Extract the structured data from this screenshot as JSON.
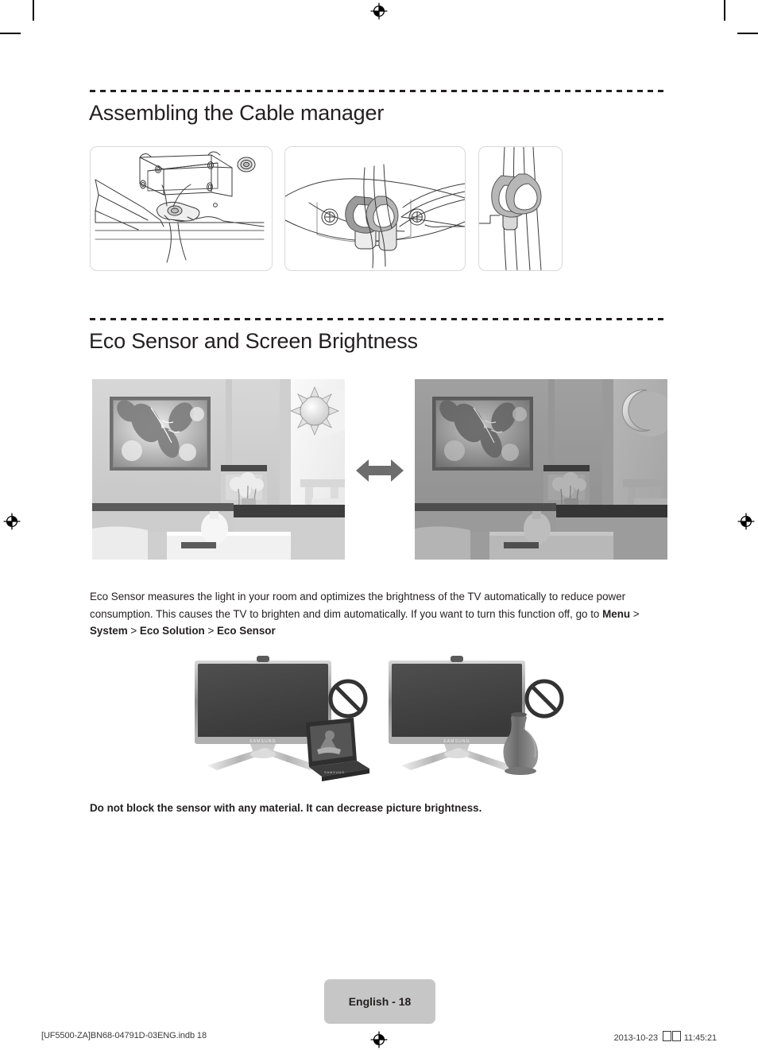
{
  "document": {
    "page_label": "English - 18",
    "footer_left": "[UF5500-ZA]BN68-04791D-03ENG.indb   18",
    "footer_date": "2013-10-23",
    "footer_time": "11:45:21",
    "footer_meridiem_glyphs": "□□"
  },
  "sections": [
    {
      "id": "cable-manager",
      "heading": "Assembling the Cable manager",
      "figures": [
        {
          "name": "tv-back-cable-manager-diagram",
          "caption": ""
        },
        {
          "name": "cable-clip-closeup-diagram",
          "caption": ""
        },
        {
          "name": "cable-clip-detail-diagram",
          "caption": ""
        }
      ]
    },
    {
      "id": "eco-sensor",
      "heading": "Eco Sensor and Screen Brightness",
      "figures": [
        {
          "name": "living-room-bright-photo",
          "icon": "sun-icon"
        },
        {
          "name": "double-arrow-icon",
          "icon": "left-right-arrow-icon"
        },
        {
          "name": "living-room-dim-photo",
          "icon": "moon-icon"
        }
      ],
      "body": {
        "part1": "Eco Sensor measures the light in your room and optimizes the brightness of the TV automatically to reduce power consumption. This causes the TV to brighten and dim automatically. If you want to turn this function off, go to ",
        "menu": "Menu",
        "sep1": " > ",
        "system": "System",
        "sep2": " > ",
        "eco_solution": "Eco Solution",
        "sep3": " > ",
        "eco_sensor": "Eco Sensor"
      },
      "warning_figures": [
        {
          "name": "tv-blocked-by-laptop-photo",
          "icon": "prohibition-icon"
        },
        {
          "name": "tv-blocked-by-vase-photo",
          "icon": "prohibition-icon"
        }
      ],
      "note": "Do not block the sensor with any material. It can decrease picture brightness."
    }
  ],
  "colors": {
    "text": "#231f20",
    "rule": "#231f20",
    "page_tab_bg": "#c6c6c6",
    "arrow": "#6d6d6d",
    "panel_border": "#d9d9d9"
  }
}
